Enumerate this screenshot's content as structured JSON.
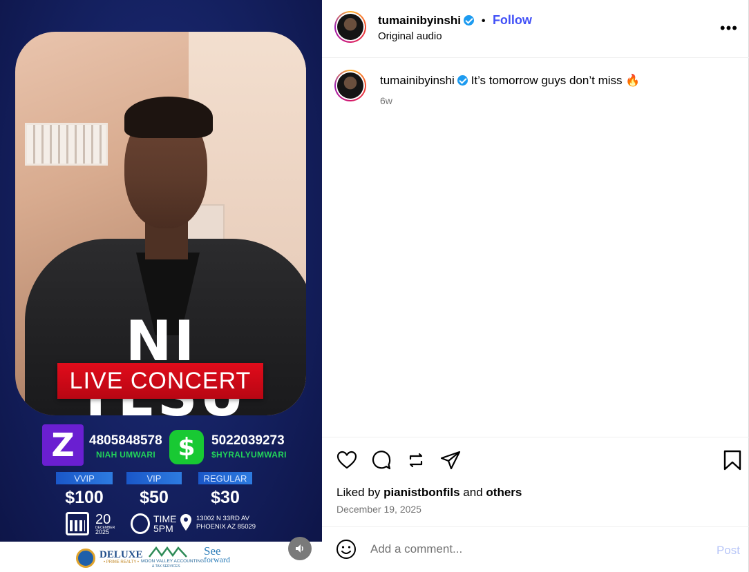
{
  "post": {
    "username": "tumainibyinshi",
    "follow_label": "Follow",
    "audio": "Original audio",
    "caption": "It’s tomorrow guys don’t miss 🔥",
    "age": "6w",
    "liked_prefix": "Liked by",
    "liked_user": "pianistbonfils",
    "liked_and": "and",
    "liked_others": "others",
    "date": "December 19, 2025",
    "comment_placeholder": "Add a comment...",
    "post_label": "Post",
    "more_label": "•••"
  },
  "media": {
    "title": "NI YESU",
    "subtitle": "LIVE CONCERT",
    "zelle_symbol": "Z",
    "zelle_number": "4805848578",
    "zelle_name": "NIAH UMWARI",
    "cashapp_symbol": "$",
    "cashapp_number": "5022039273",
    "cashapp_name": "$HYRALYUMWARI",
    "tiers": [
      {
        "label": "VVIP",
        "price": "$100"
      },
      {
        "label": "VIP",
        "price": "$50"
      },
      {
        "label": "REGULAR",
        "price": "$30"
      }
    ],
    "day": "20",
    "month": "DECEMBER",
    "year": "2025",
    "time_label": "TIME",
    "time_value": "5PM",
    "address_line1": "13002 N 33RD AV",
    "address_line2": "PHOENIX AZ 85029",
    "sponsors": {
      "deluxe": "DELUXE",
      "deluxe_sub": "• PRIME REALTY •",
      "moonvalley": "MOON VALLEY ACCOUNTING",
      "moonvalley_sub": "& TAX SERVICES",
      "seeforward_1": "See",
      "seeforward_2": "forward"
    }
  },
  "colors": {
    "follow": "#4150f7",
    "accent_red": "#e10c1b",
    "zelle": "#6a1fd1",
    "cashapp": "#18c933",
    "verified": "#1d9bf0"
  }
}
